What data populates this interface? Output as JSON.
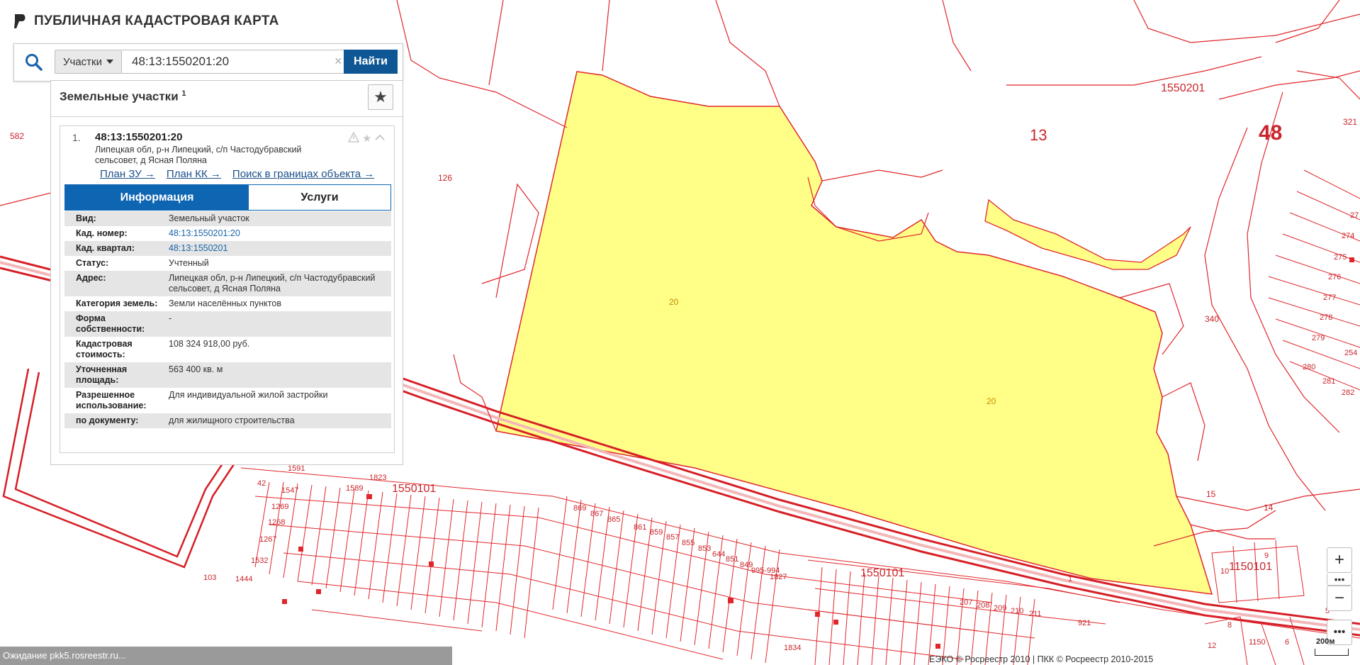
{
  "app": {
    "title": "ПУБЛИЧНАЯ КАДАСТРОВАЯ КАРТА"
  },
  "search": {
    "type_label": "Участки",
    "query": "48:13:1550201:20",
    "clear": "×",
    "button": "Найти"
  },
  "results": {
    "header": "Земельные участки",
    "count": "1",
    "favorites_icon": "★",
    "item": {
      "index": "1.",
      "title": "48:13:1550201:20",
      "address": "Липецкая обл, р-н Липецкий, с/п Частодубравский сельсовет, д Ясная Поляна",
      "links": [
        "План ЗУ →",
        "План КК →",
        "Поиск в границах объекта →"
      ],
      "tabs": [
        "Информация",
        "Услуги"
      ],
      "info": [
        {
          "key": "Вид:",
          "value": "Земельный участок"
        },
        {
          "key": "Кад. номер:",
          "value": "48:13:1550201:20"
        },
        {
          "key": "Кад. квартал:",
          "value": "48:13:1550201"
        },
        {
          "key": "Статус:",
          "value": "Учтенный"
        },
        {
          "key": "Адрес:",
          "value": "Липецкая обл, р-н Липецкий, с/п Частодубравский сельсовет, д Ясная Поляна"
        },
        {
          "key": "Категория земель:",
          "value": "Земли населённых пунктов"
        },
        {
          "key": "Форма собственности:",
          "value": "-"
        },
        {
          "key": "Кадастровая стоимость:",
          "value": "108 324 918,00 руб."
        },
        {
          "key": "Уточненная площадь:",
          "value": "563 400 кв. м"
        },
        {
          "key": "Разрешенное использование:",
          "value": "Для индивидуальной жилой застройки"
        },
        {
          "key": "по документу:",
          "value": "для жилищного строительства"
        }
      ]
    }
  },
  "map": {
    "labels": {
      "l582": "582",
      "l126": "126",
      "l1550201": "1550201",
      "l13": "13",
      "l48": "48",
      "l321": "321",
      "l340": "340",
      "l20a": "20",
      "l20b": "20",
      "l15": "15",
      "l14": "14",
      "l1550101a": "1550101",
      "l1550101b": "1550101",
      "l1150101": "1150101",
      "l1823": "1823",
      "l1591": "1591",
      "l1589": "1589",
      "l42": "42",
      "l1547": "1547",
      "l1269": "1269",
      "l1268": "1268",
      "l1267": "1267",
      "l1532": "1532",
      "l1444": "1444",
      "l103": "103",
      "l869": "869",
      "l867": "867",
      "l865": "865",
      "l861": "861",
      "l859": "859",
      "l857": "857",
      "l855": "855",
      "l853": "853",
      "l644": "644",
      "l851": "851",
      "l849": "849",
      "l995": "995-994",
      "l1827": "1827",
      "l921": "921",
      "l207": "207",
      "l208": "208",
      "l209": "209",
      "l210": "210",
      "l211": "211",
      "l274": "274",
      "l275": "275",
      "l276": "276",
      "l277": "277",
      "l278": "278",
      "l279": "279",
      "l280": "280",
      "l281": "281",
      "l282": "282",
      "l254": "254",
      "l27": "27",
      "l10": "10",
      "l9": "9",
      "l8": "8",
      "l12": "12",
      "l6": "6",
      "l1150": "1150",
      "l1": "1",
      "l5": "5",
      "l1834": "1834"
    }
  },
  "controls": {
    "zoom_in": "+",
    "zoom_out": "−",
    "more": "•••",
    "scale": "200м"
  },
  "status": "Ожидание pkk5.rosreestr.ru...",
  "copyright": "ЕЭКО © Росреестр 2010 | ПКК © Росреестр 2010-2015"
}
